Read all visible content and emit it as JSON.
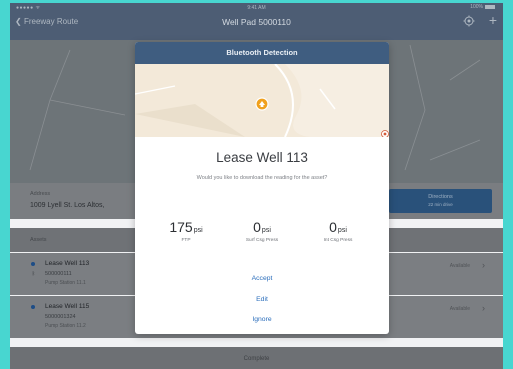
{
  "status_bar": {
    "carrier": "●●●●● ᯤ",
    "time": "9:41 AM",
    "battery": "100%"
  },
  "nav": {
    "back_label": "Freeway Route",
    "title": "Well Pad 5000110"
  },
  "address": {
    "label": "Address",
    "value": "1009 Lyell St. Los Altos,"
  },
  "directions": {
    "label": "Directions",
    "time": "22 min drive"
  },
  "assets": {
    "title": "Assets",
    "items": [
      {
        "name": "Lease Well 113",
        "id": "500000111",
        "station": "Pump Station 11.1",
        "status": "Available",
        "bluetooth": true
      },
      {
        "name": "Lease Well 115",
        "id": "5000001324",
        "station": "Pump Station 11.2",
        "status": "Available",
        "bluetooth": false
      }
    ]
  },
  "complete_label": "Complete",
  "modal": {
    "title": "Bluetooth Detection",
    "well_name": "Lease Well 113",
    "question": "Would you like to download the reading for the asset?",
    "readings": [
      {
        "value": "175",
        "unit": "psi",
        "label": "FTP"
      },
      {
        "value": "0",
        "unit": "psi",
        "label": "Surf Csg Press"
      },
      {
        "value": "0",
        "unit": "psi",
        "label": "Int Csg Press"
      }
    ],
    "actions": {
      "accept": "Accept",
      "edit": "Edit",
      "ignore": "Ignore"
    }
  },
  "colors": {
    "accent": "#2a6dbb",
    "header": "#3f5d80",
    "directions": "#29517a",
    "marker": "#f0a11e"
  },
  "icons": [
    "back-chevron-icon",
    "settings-icon",
    "add-icon",
    "bluetooth-icon",
    "chevron-right-icon",
    "map-marker-icon"
  ]
}
